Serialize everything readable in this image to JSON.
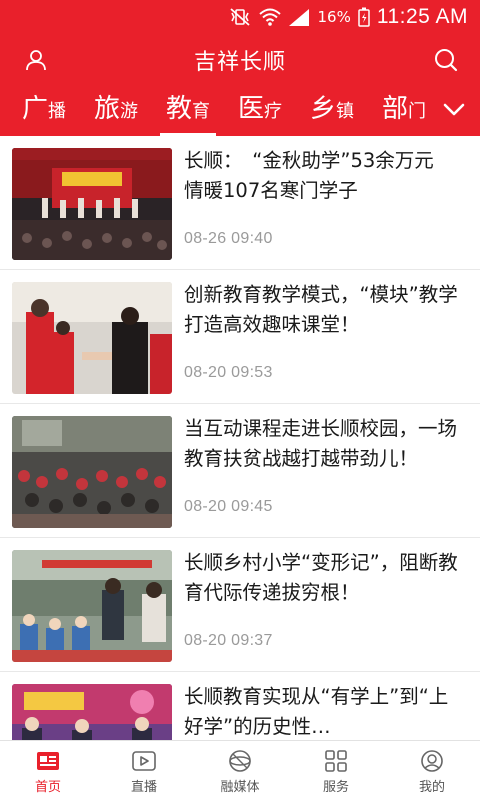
{
  "status": {
    "battery": "16%",
    "time": "11:25 AM"
  },
  "header": {
    "title": "吉祥长顺"
  },
  "tabs": [
    {
      "big": "广",
      "small": "播"
    },
    {
      "big": "旅",
      "small": "游"
    },
    {
      "big": "教",
      "small": "育",
      "active": true
    },
    {
      "big": "医",
      "small": "疗"
    },
    {
      "big": "乡",
      "small": "镇"
    },
    {
      "big": "部",
      "small": "门"
    }
  ],
  "articles": [
    {
      "title": "长顺：　“金秋助学”53余万元　情暖107名寒门学子",
      "date": "08-26  09:40"
    },
    {
      "title": "创新教育教学模式，“模块”教学打造高效趣味课堂！",
      "date": "08-20  09:53"
    },
    {
      "title": "当互动课程走进长顺校园，一场教育扶贫战越打越带劲儿！",
      "date": "08-20  09:45"
    },
    {
      "title": "长顺乡村小学“变形记”，阻断教育代际传递拔穷根！",
      "date": "08-20  09:37"
    },
    {
      "title": "长顺教育实现从“有学上”到“上好学”的历史性…",
      "date": ""
    }
  ],
  "nav": [
    {
      "label": "首页",
      "icon": "home-news-icon",
      "active": true
    },
    {
      "label": "直播",
      "icon": "play-icon"
    },
    {
      "label": "融媒体",
      "icon": "globe-icon"
    },
    {
      "label": "服务",
      "icon": "grid-icon"
    },
    {
      "label": "我的",
      "icon": "user-icon"
    }
  ],
  "colors": {
    "brand": "#e9202b"
  }
}
